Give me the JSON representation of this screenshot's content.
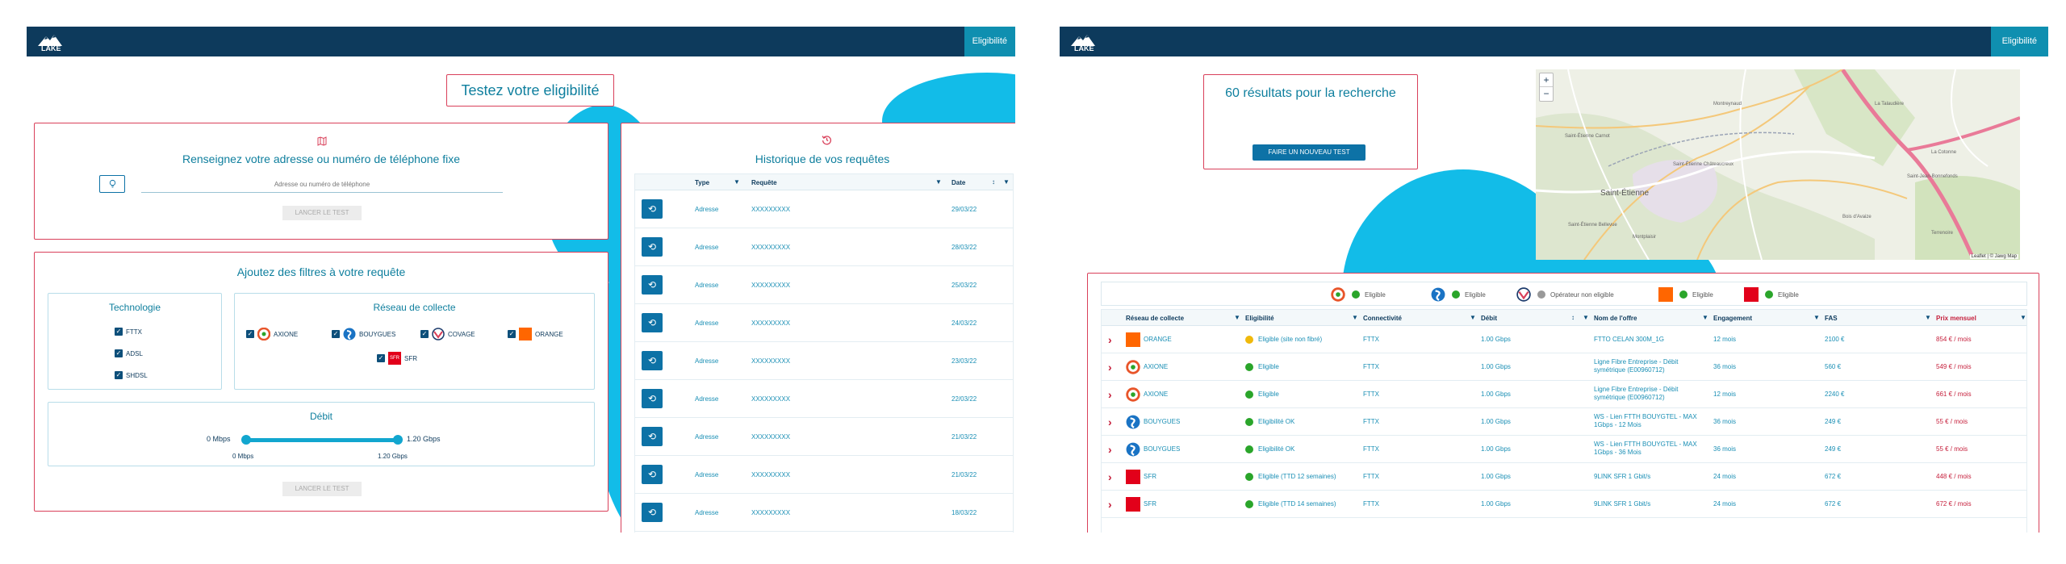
{
  "left": {
    "nav": {
      "logo_text": "LAKE",
      "tab_label": "Eligibilité"
    },
    "title": "Testez votre eligibilité",
    "address_card": {
      "heading": "Renseignez votre adresse ou numéro de téléphone fixe",
      "input_placeholder": "Adresse ou numéro de téléphone",
      "button_label": "LANCER LE TEST"
    },
    "filters_card": {
      "heading": "Ajoutez des filtres à votre requête",
      "technology": {
        "heading": "Technologie",
        "options": [
          "FTTX",
          "ADSL",
          "SHDSL"
        ]
      },
      "network": {
        "heading": "Réseau de collecte",
        "options": [
          "AXIONE",
          "BOUYGUES",
          "COVAGE",
          "ORANGE",
          "SFR"
        ]
      },
      "speed": {
        "heading": "Débit",
        "min_label": "0 Mbps",
        "max_label": "1.20 Gbps",
        "min_value": "0 Mbps",
        "max_value": "1.20 Gbps"
      },
      "button_label": "LANCER LE TEST"
    },
    "history": {
      "heading": "Historique de vos requêtes",
      "columns": [
        "Type",
        "Requête",
        "Date"
      ],
      "rows": [
        {
          "type": "Adresse",
          "query": "XXXXXXXXX",
          "date": "29/03/22"
        },
        {
          "type": "Adresse",
          "query": "XXXXXXXXX",
          "date": "28/03/22"
        },
        {
          "type": "Adresse",
          "query": "XXXXXXXXX",
          "date": "25/03/22"
        },
        {
          "type": "Adresse",
          "query": "XXXXXXXXX",
          "date": "24/03/22"
        },
        {
          "type": "Adresse",
          "query": "XXXXXXXXX",
          "date": "23/03/22"
        },
        {
          "type": "Adresse",
          "query": "XXXXXXXXX",
          "date": "22/03/22"
        },
        {
          "type": "Adresse",
          "query": "XXXXXXXXX",
          "date": "21/03/22"
        },
        {
          "type": "Adresse",
          "query": "XXXXXXXXX",
          "date": "21/03/22"
        },
        {
          "type": "Adresse",
          "query": "XXXXXXXXX",
          "date": "18/03/22"
        }
      ]
    }
  },
  "right": {
    "nav": {
      "logo_text": "LAKE",
      "tab_label": "Eligibilité"
    },
    "results": {
      "heading": "60 résultats pour la recherche",
      "button_label": "FAIRE UN NOUVEAU TEST"
    },
    "map": {
      "zoom_in": "+",
      "zoom_out": "−",
      "attribution": "Leaflet | © Jawg Map",
      "labels": [
        "Saint-Étienne",
        "Saint-Étienne Châteaucreux",
        "Saint-Étienne Carnot",
        "Saint-Étienne Bellevue",
        "Bois d'Avaize",
        "Terrenoire",
        "Montreynaud",
        "La Talaudière",
        "Saint-Jean-Bonnefonds",
        "La Cotonne",
        "Montplaisir"
      ]
    },
    "legend": [
      {
        "operator": "AXIONE",
        "status": "Eligible",
        "color": "#2aa52a"
      },
      {
        "operator": "BOUYGUES",
        "status": "Eligible",
        "color": "#2aa52a"
      },
      {
        "operator": "COVAGE",
        "status": "Opérateur non eligible",
        "color": "#999999"
      },
      {
        "operator": "ORANGE",
        "status": "Eligible",
        "color": "#2aa52a"
      },
      {
        "operator": "SFR",
        "status": "Eligible",
        "color": "#2aa52a"
      }
    ],
    "columns": [
      "Réseau de collecte",
      "Eligibilité",
      "Connectivité",
      "Débit",
      "Nom de l'offre",
      "Engagement",
      "FAS",
      "Prix mensuel"
    ],
    "rows": [
      {
        "network": "ORANGE",
        "eligibility": "Eligible (site non fibré)",
        "status_color": "#f0b90b",
        "connectivity": "FTTX",
        "speed": "1.00 Gbps",
        "offer": "FTTO CELAN 300M_1G",
        "commitment": "12 mois",
        "fas": "2100 €",
        "price": "854 € / mois"
      },
      {
        "network": "AXIONE",
        "eligibility": "Eligible",
        "status_color": "#2aa52a",
        "connectivity": "FTTX",
        "speed": "1.00 Gbps",
        "offer": "Ligne Fibre Entreprise - Débit symétrique (E00960712)",
        "commitment": "36 mois",
        "fas": "560 €",
        "price": "549 € / mois"
      },
      {
        "network": "AXIONE",
        "eligibility": "Eligible",
        "status_color": "#2aa52a",
        "connectivity": "FTTX",
        "speed": "1.00 Gbps",
        "offer": "Ligne Fibre Entreprise - Débit symétrique (E00960712)",
        "commitment": "12 mois",
        "fas": "2240 €",
        "price": "661 € / mois"
      },
      {
        "network": "BOUYGUES",
        "eligibility": "Eligibilité OK",
        "status_color": "#2aa52a",
        "connectivity": "FTTX",
        "speed": "1.00 Gbps",
        "offer": "WS - Lien FTTH BOUYGTEL - MAX 1Gbps - 12 Mois",
        "commitment": "36 mois",
        "fas": "249 €",
        "price": "55 € / mois"
      },
      {
        "network": "BOUYGUES",
        "eligibility": "Eligibilité OK",
        "status_color": "#2aa52a",
        "connectivity": "FTTX",
        "speed": "1.00 Gbps",
        "offer": "WS - Lien FTTH BOUYGTEL - MAX 1Gbps - 36 Mois",
        "commitment": "36 mois",
        "fas": "249 €",
        "price": "55 € / mois"
      },
      {
        "network": "SFR",
        "eligibility": "Eligible (TTD 12 semaines)",
        "status_color": "#2aa52a",
        "connectivity": "FTTX",
        "speed": "1.00 Gbps",
        "offer": "9LINK SFR 1 Gbit/s",
        "commitment": "24 mois",
        "fas": "672 €",
        "price": "448 € / mois"
      },
      {
        "network": "SFR",
        "eligibility": "Eligible (TTD 14 semaines)",
        "status_color": "#2aa52a",
        "connectivity": "FTTX",
        "speed": "1.00 Gbps",
        "offer": "9LINK SFR 1 Gbit/s",
        "commitment": "24 mois",
        "fas": "672 €",
        "price": "672 € / mois"
      }
    ]
  }
}
